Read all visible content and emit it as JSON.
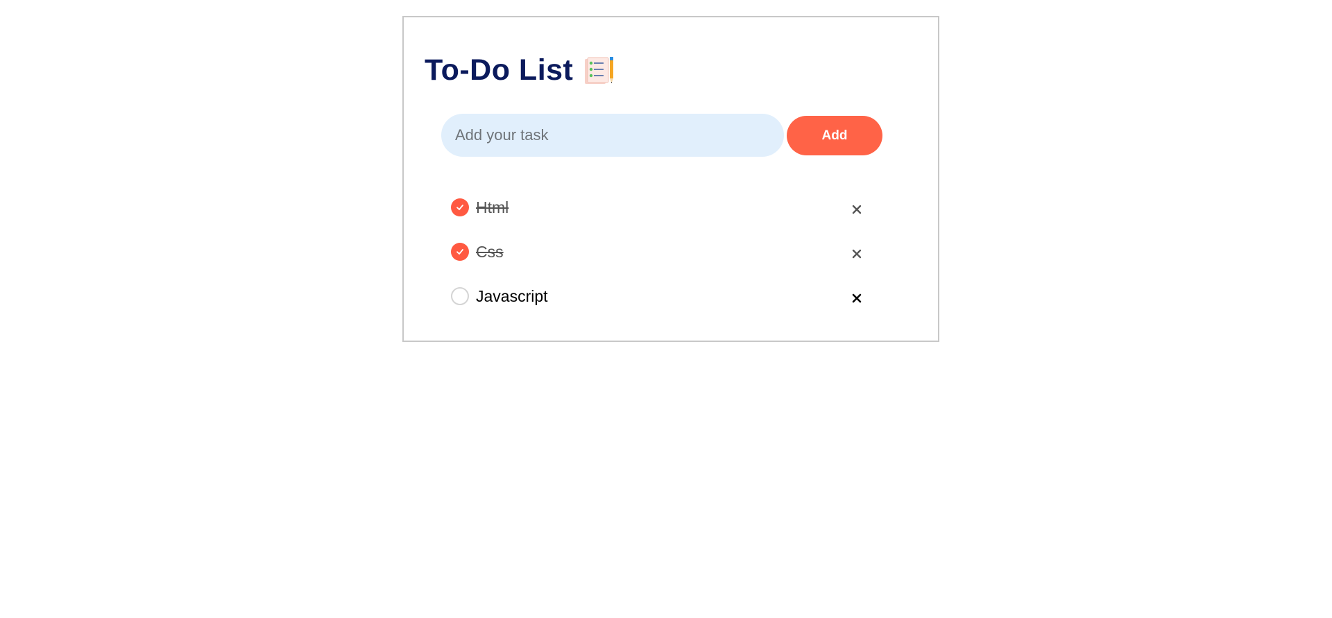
{
  "app": {
    "title": "To-Do List",
    "title_icon": "checklist-notepad-pencil-icon",
    "title_color": "#0b1a5c",
    "accent_color": "#ff6347"
  },
  "add_form": {
    "placeholder": "Add your task",
    "value": "",
    "button_label": "Add"
  },
  "tasks": [
    {
      "text": "Html",
      "checked": true,
      "delete_icon": "close-icon"
    },
    {
      "text": "Css",
      "checked": true,
      "delete_icon": "close-icon"
    },
    {
      "text": "Javascript",
      "checked": false,
      "delete_icon": "close-icon"
    }
  ]
}
